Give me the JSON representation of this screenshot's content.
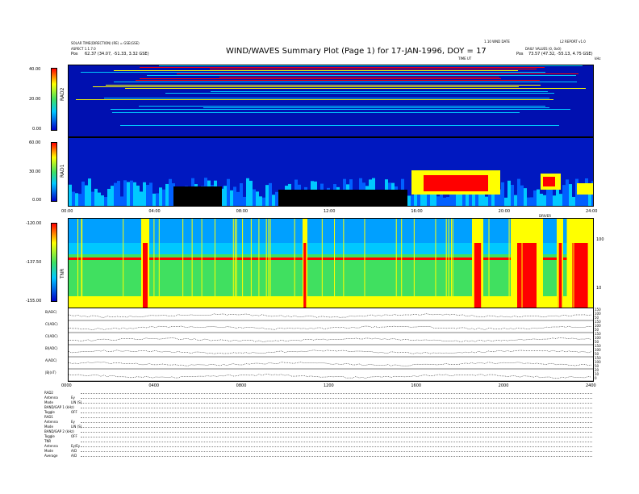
{
  "header": {
    "title": "WIND/WAVES Summary Plot (Page 1) for 17-JAN-1996, DOY = 17",
    "left_line1": "SOLAR TIME(DIRECTION) (RE) = GSE(GSE)",
    "left_line2": "ASPECT 1.1.7.0",
    "left_line3": "Pos",
    "left_pos": "62.37 (34.07, -51.33, 3.32 GSE)",
    "center_right_label": "1.10 WND DATE",
    "right_line1": "L2 REPORT v1.0",
    "right_line2": "DAILY VALUES (0, 0x0)",
    "right_line3": "Pos",
    "right_pos": "73.57 (47.32, -55.13, 4.75 GSE)",
    "ticks_label": "TIME UT",
    "hrs_label": "kHz"
  },
  "chart_data": [
    {
      "type": "heatmap",
      "name": "RAD2",
      "ylabel": "RAD2",
      "colorbar_ticks": [
        "40.00",
        "20.00",
        "0.00"
      ],
      "colorbar_range": [
        0,
        40
      ]
    },
    {
      "type": "heatmap",
      "name": "RAD1",
      "ylabel": "RAD1",
      "colorbar_ticks": [
        "60.00",
        "30.00",
        "0.00"
      ],
      "colorbar_range": [
        0,
        60
      ],
      "x_ticks": [
        "00:00",
        "04:00",
        "08:00",
        "12:00",
        "16:00",
        "20:00",
        "24:00"
      ]
    },
    {
      "type": "heatmap",
      "name": "TNR",
      "ylabel": "TNR",
      "colorbar_ticks": [
        "-120.00",
        "-137.50",
        "-155.00"
      ],
      "colorbar_range": [
        -155,
        -120
      ],
      "right_ticks": [
        "100",
        "10"
      ],
      "top_label": "DRIVER"
    },
    {
      "type": "line",
      "name": "traces",
      "series": [
        {
          "name": "B(ADC)",
          "right_ticks": [
            "150",
            "100",
            "50"
          ]
        },
        {
          "name": "Cl(ADC)",
          "right_ticks": [
            "150",
            "100",
            "50"
          ]
        },
        {
          "name": "Cl(ADC)",
          "right_ticks": [
            "150",
            "100",
            "50"
          ]
        },
        {
          "name": "Bl(ADC)",
          "right_ticks": [
            "150",
            "100",
            "50"
          ]
        },
        {
          "name": "A(ADC)",
          "right_ticks": [
            "150",
            "100",
            "50"
          ]
        },
        {
          "name": "|B|(nT)",
          "right_ticks": [
            "20",
            "10",
            "0"
          ]
        }
      ],
      "x_ticks": [
        "0000",
        "0400",
        "0800",
        "1200",
        "1600",
        "2000",
        "2400"
      ]
    }
  ],
  "footer": {
    "rows": [
      {
        "label": "RAD2",
        "value": ""
      },
      {
        "label": "Antenna",
        "value": "Ey"
      },
      {
        "label": "Mode",
        "value": "LIN (S)"
      },
      {
        "label": "BAND/GAP 1 (kHz)",
        "value": ""
      },
      {
        "label": "Toggle",
        "value": "OFF"
      },
      {
        "label": "RAD1",
        "value": ""
      },
      {
        "label": "Antenna",
        "value": "Ey"
      },
      {
        "label": "Mode",
        "value": "LIN (S)"
      },
      {
        "label": "BAND/GAP 2 (kHz)",
        "value": ""
      },
      {
        "label": "Toggle",
        "value": "OFF"
      },
      {
        "label": "TNR",
        "value": ""
      },
      {
        "label": "Antenna",
        "value": "Ey/Ey"
      },
      {
        "label": "Mode",
        "value": "A/D"
      },
      {
        "label": "Average",
        "value": "A/D"
      }
    ]
  },
  "colors": {
    "lo": "#0000c8",
    "mid": "#00c8ff",
    "green": "#40e060",
    "yellow": "#ffff00",
    "red": "#ff0000",
    "dark": "#000000"
  }
}
